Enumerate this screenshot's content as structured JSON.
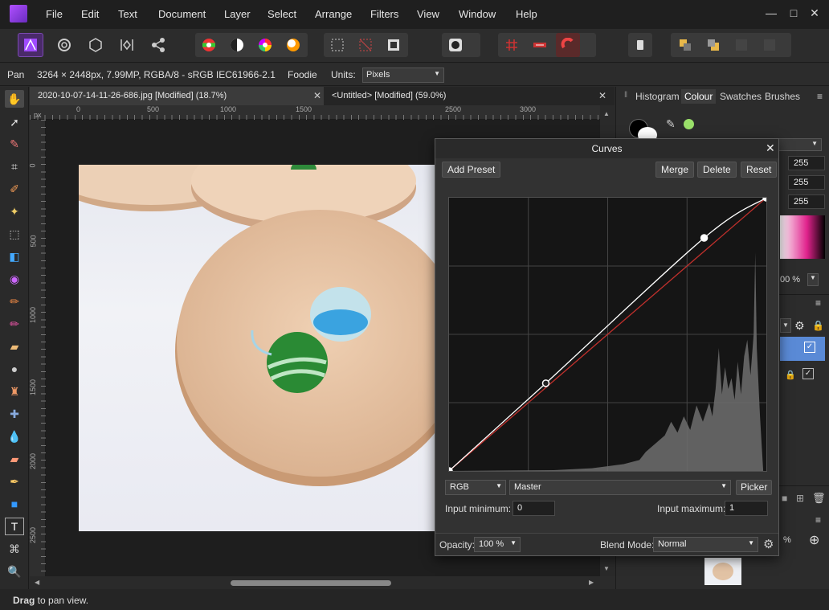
{
  "menu": [
    "File",
    "Edit",
    "Text",
    "Document",
    "Layer",
    "Select",
    "Arrange",
    "Filters",
    "View",
    "Window",
    "Help"
  ],
  "context": {
    "tool_name": "Pan",
    "doc_info": "3264 × 2448px, 7.99MP, RGBA/8 - sRGB IEC61966-2.1",
    "preset": "Foodie",
    "units_label": "Units:",
    "units_value": "Pixels"
  },
  "tabs": [
    {
      "label": "2020-10-07-14-11-26-686.jpg [Modified] (18.7%)"
    },
    {
      "label": "<Untitled> [Modified] (59.0%)"
    }
  ],
  "ruler": {
    "unit": "px",
    "top_ticks": [
      "0",
      "500",
      "1000",
      "1500",
      "2000",
      "2500",
      "3000"
    ],
    "left_ticks": [
      "0",
      "500",
      "1000",
      "1500",
      "2000",
      "2500"
    ]
  },
  "right_panel": {
    "tabs": [
      "Histogram",
      "Colour",
      "Swatches",
      "Brushes"
    ],
    "active_tab": "Colour",
    "values": [
      "255",
      "255",
      "255"
    ],
    "opacity": "00 %",
    "layer_opacity": "%"
  },
  "curves": {
    "title": "Curves",
    "add_preset": "Add Preset",
    "merge": "Merge",
    "delete": "Delete",
    "reset": "Reset",
    "channel": "RGB",
    "mode": "Master",
    "picker": "Picker",
    "input_min_label": "Input minimum:",
    "input_min": "0",
    "input_max_label": "Input maximum:",
    "input_max": "1",
    "opacity_label": "Opacity:",
    "opacity": "100 %",
    "blend_label": "Blend Mode:",
    "blend": "Normal",
    "points": [
      [
        0,
        0
      ],
      [
        0.305,
        0.321
      ],
      [
        0.804,
        0.853
      ],
      [
        1,
        1
      ]
    ]
  },
  "status": {
    "bold": "Drag",
    "rest": " to pan view."
  },
  "colors": {
    "accent": "#a04bff",
    "curve": "#ffffff",
    "diagonal": "#c0302c",
    "swatch_active": "#9ae06a"
  }
}
